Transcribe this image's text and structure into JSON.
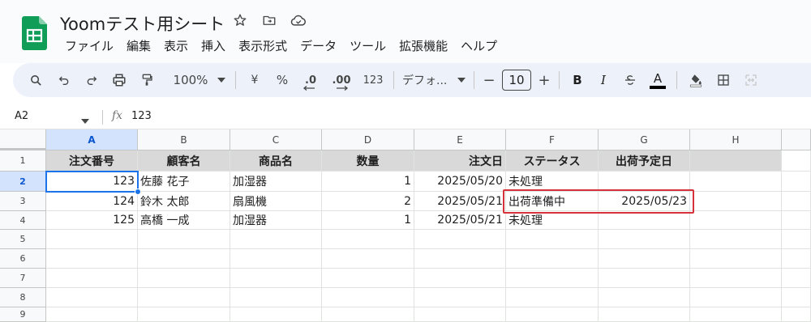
{
  "app": {
    "title": "Yoomテスト用シート",
    "brand_color": "#0f9d58"
  },
  "menu": [
    "ファイル",
    "編集",
    "表示",
    "挿入",
    "表示形式",
    "データ",
    "ツール",
    "拡張機能",
    "ヘルプ"
  ],
  "toolbar": {
    "zoom": "100%",
    "currency": "¥",
    "percent": "%",
    "decrease_decimal": ".0",
    "increase_decimal": ".00",
    "number_format": "123",
    "font": "デフォ...",
    "font_size": "10",
    "bold": "B",
    "italic": "I",
    "text_color_label": "A",
    "minus": "−",
    "plus": "+"
  },
  "formula_bar": {
    "name_box": "A2",
    "fx": "fx",
    "value": "123"
  },
  "columns": [
    "A",
    "B",
    "C",
    "D",
    "E",
    "F",
    "G",
    "H"
  ],
  "rows": [
    "1",
    "2",
    "3",
    "4",
    "5",
    "6",
    "7",
    "8",
    "9"
  ],
  "headers": [
    "注文番号",
    "顧客名",
    "商品名",
    "数量",
    "注文日",
    "ステータス",
    "出荷予定日"
  ],
  "data_rows": [
    [
      "123",
      "佐藤 花子",
      "加湿器",
      "1",
      "2025/05/20",
      "未処理",
      ""
    ],
    [
      "124",
      "鈴木 太郎",
      "扇風機",
      "2",
      "2025/05/21",
      "出荷準備中",
      "2025/05/23"
    ],
    [
      "125",
      "高橋 一成",
      "加湿器",
      "1",
      "2025/05/21",
      "未処理",
      ""
    ]
  ],
  "selection": {
    "active_cell": "A2",
    "selection_color": "#1a73e8",
    "highlight_color": "#d6323b"
  }
}
